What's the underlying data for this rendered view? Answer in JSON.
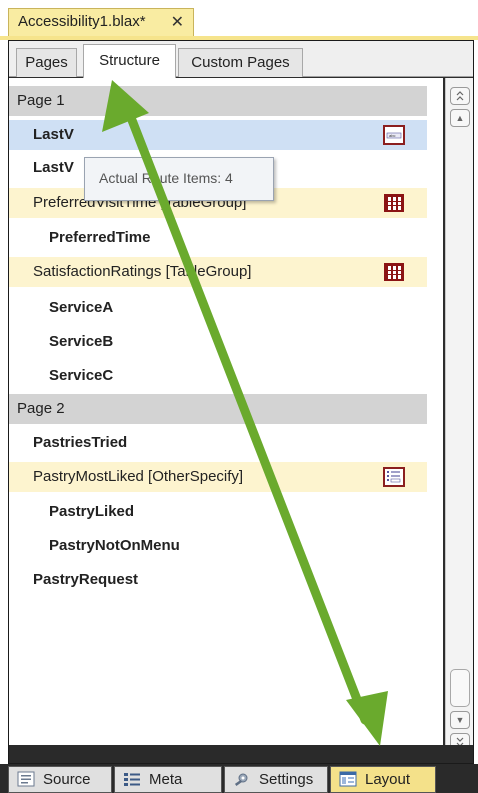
{
  "document_tab": {
    "title": "Accessibility1.blax*",
    "close_glyph": "✕"
  },
  "sub_tabs": [
    "Pages",
    "Structure",
    "Custom Pages"
  ],
  "active_sub_tab": "Structure",
  "rows": [
    {
      "label": "Page 1"
    },
    {
      "label": "LastV"
    },
    {
      "label": "LastV"
    },
    {
      "label": "PreferredVisitTime [TableGroup]"
    },
    {
      "label": "PreferredTime"
    },
    {
      "label": "SatisfactionRatings [TableGroup]"
    },
    {
      "label": "ServiceA"
    },
    {
      "label": "ServiceB"
    },
    {
      "label": "ServiceC"
    },
    {
      "label": "Page 2"
    },
    {
      "label": "PastriesTried"
    },
    {
      "label": "PastryMostLiked [OtherSpecify]"
    },
    {
      "label": "PastryLiked"
    },
    {
      "label": "PastryNotOnMenu"
    },
    {
      "label": "PastryRequest"
    }
  ],
  "tooltip": "Actual Route Items: 4",
  "bottom_tabs": [
    {
      "label": "Source",
      "icon": "source-icon"
    },
    {
      "label": "Meta",
      "icon": "meta-icon"
    },
    {
      "label": "Settings",
      "icon": "settings-icon"
    },
    {
      "label": "Layout",
      "icon": "layout-icon"
    }
  ],
  "active_bottom_tab": "Layout",
  "colors": {
    "accent_yellow": "#f9eca2",
    "group_row": "#fdf4cf",
    "page_header": "#d3d3d3",
    "selected_row": "#cfe0f4",
    "arrow_green": "#6aaa2d"
  },
  "scroll_buttons": [
    "▲",
    "▼"
  ]
}
